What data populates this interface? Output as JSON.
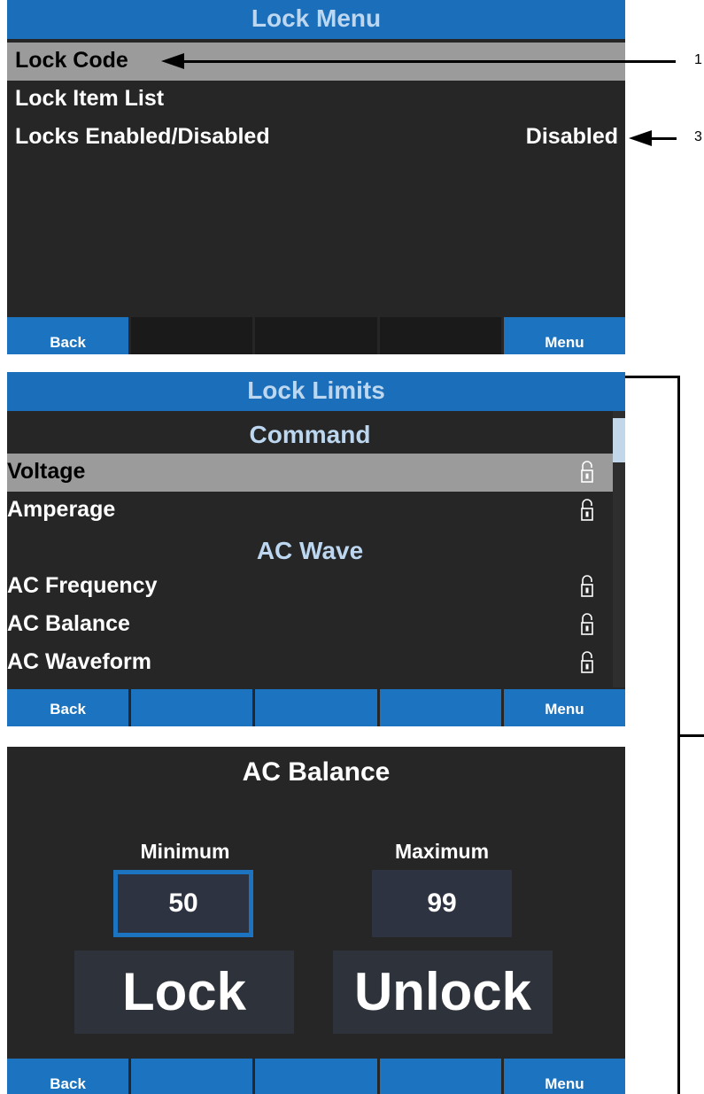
{
  "lock_menu": {
    "title": "Lock Menu",
    "items": [
      {
        "label": "Lock Code",
        "value": ""
      },
      {
        "label": "Lock Item List",
        "value": ""
      },
      {
        "label": "Locks Enabled/Disabled",
        "value": "Disabled"
      }
    ],
    "softkeys": [
      "Back",
      "",
      "",
      "",
      "Menu"
    ]
  },
  "lock_limits": {
    "title": "Lock Limits",
    "sections": [
      {
        "heading": "Command",
        "items": [
          "Voltage",
          "Amperage"
        ]
      },
      {
        "heading": "AC Wave",
        "items": [
          "AC Frequency",
          "AC Balance",
          "AC Waveform"
        ]
      }
    ],
    "item_icon": "unlocked-padlock-icon",
    "softkeys": [
      "Back",
      "",
      "",
      "",
      "Menu"
    ]
  },
  "ac_balance": {
    "title": "AC Balance",
    "minimum_label": "Minimum",
    "minimum_value": "50",
    "maximum_label": "Maximum",
    "maximum_value": "99",
    "lock_label": "Lock",
    "unlock_label": "Unlock",
    "softkeys": [
      "Back",
      "",
      "",
      "",
      "Menu"
    ]
  },
  "callouts": {
    "one": "1",
    "three": "3"
  },
  "colors": {
    "accent_blue": "#1c74c0",
    "title_text": "#bcd7ef",
    "screen_bg": "#262626",
    "selected_row": "#9b9b9b"
  }
}
